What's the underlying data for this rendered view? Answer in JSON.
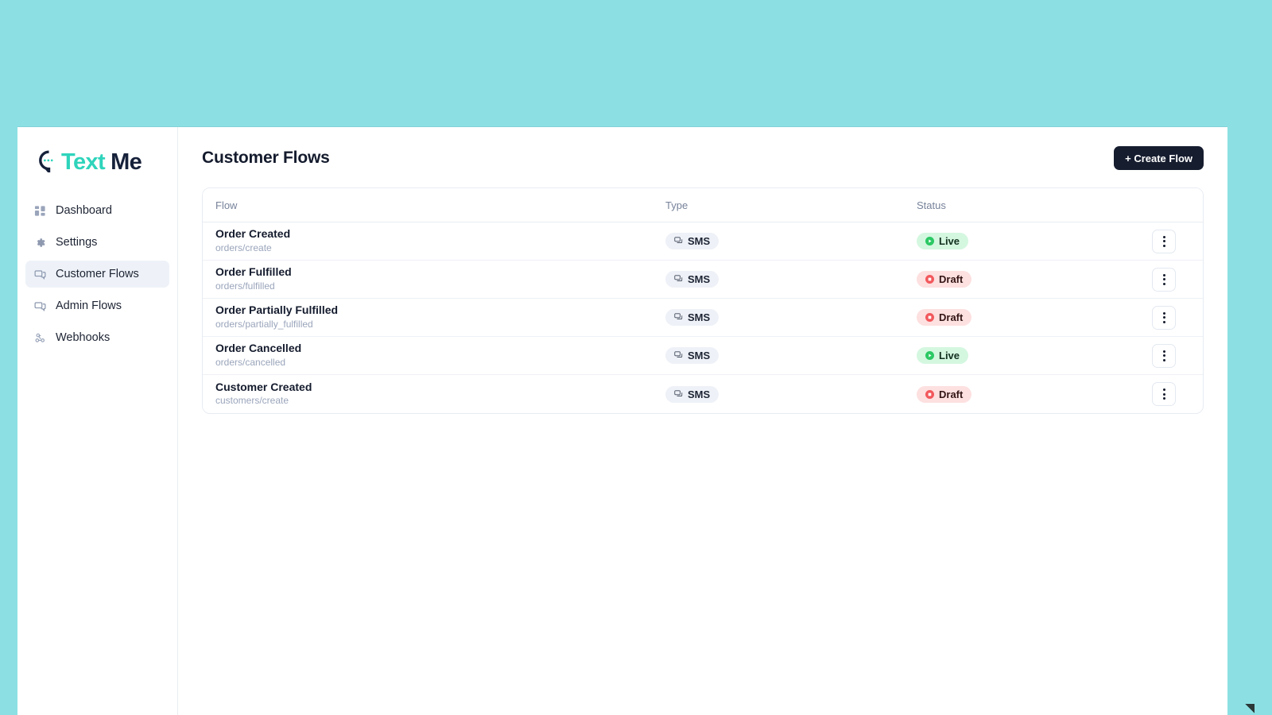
{
  "theme": {
    "page_background": "#8ce0e3",
    "accent_teal": "#2ed4bb",
    "ink": "#161d2f",
    "live_green": "#d4f7e0",
    "draft_red": "#fde0e0"
  },
  "brand": {
    "name_part1": "Text",
    "name_part2": "Me",
    "mark": "speech-bubble-icon"
  },
  "sidebar": {
    "items": [
      {
        "label": "Dashboard",
        "icon": "grid-icon",
        "active": false
      },
      {
        "label": "Settings",
        "icon": "gear-icon",
        "active": false
      },
      {
        "label": "Customer Flows",
        "icon": "message-square-icon",
        "active": true
      },
      {
        "label": "Admin Flows",
        "icon": "message-square-icon",
        "active": false
      },
      {
        "label": "Webhooks",
        "icon": "webhook-icon",
        "active": false
      }
    ]
  },
  "header": {
    "title": "Customer Flows",
    "create_button": "+ Create Flow"
  },
  "table": {
    "columns": [
      "Flow",
      "Type",
      "Status"
    ],
    "rows": [
      {
        "name": "Order Created",
        "topic": "orders/create",
        "type": "SMS",
        "status": "Live"
      },
      {
        "name": "Order Fulfilled",
        "topic": "orders/fulfilled",
        "type": "SMS",
        "status": "Draft"
      },
      {
        "name": "Order Partially Fulfilled",
        "topic": "orders/partially_fulfilled",
        "type": "SMS",
        "status": "Draft"
      },
      {
        "name": "Order Cancelled",
        "topic": "orders/cancelled",
        "type": "SMS",
        "status": "Live"
      },
      {
        "name": "Customer Created",
        "topic": "customers/create",
        "type": "SMS",
        "status": "Draft"
      }
    ]
  }
}
